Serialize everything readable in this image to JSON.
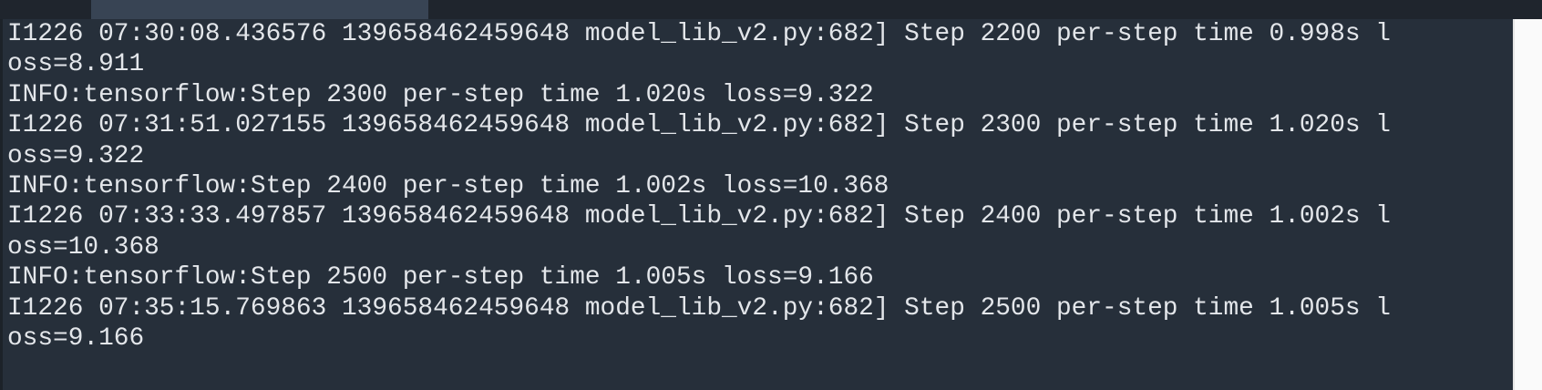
{
  "terminal": {
    "lines": [
      "I1226 07:30:08.436576 139658462459648 model_lib_v2.py:682] Step 2200 per-step time 0.998s l",
      "oss=8.911",
      "INFO:tensorflow:Step 2300 per-step time 1.020s loss=9.322",
      "I1226 07:31:51.027155 139658462459648 model_lib_v2.py:682] Step 2300 per-step time 1.020s l",
      "oss=9.322",
      "INFO:tensorflow:Step 2400 per-step time 1.002s loss=10.368",
      "I1226 07:33:33.497857 139658462459648 model_lib_v2.py:682] Step 2400 per-step time 1.002s l",
      "oss=10.368",
      "INFO:tensorflow:Step 2500 per-step time 1.005s loss=9.166",
      "I1226 07:35:15.769863 139658462459648 model_lib_v2.py:682] Step 2500 per-step time 1.005s l",
      "oss=9.166"
    ]
  }
}
